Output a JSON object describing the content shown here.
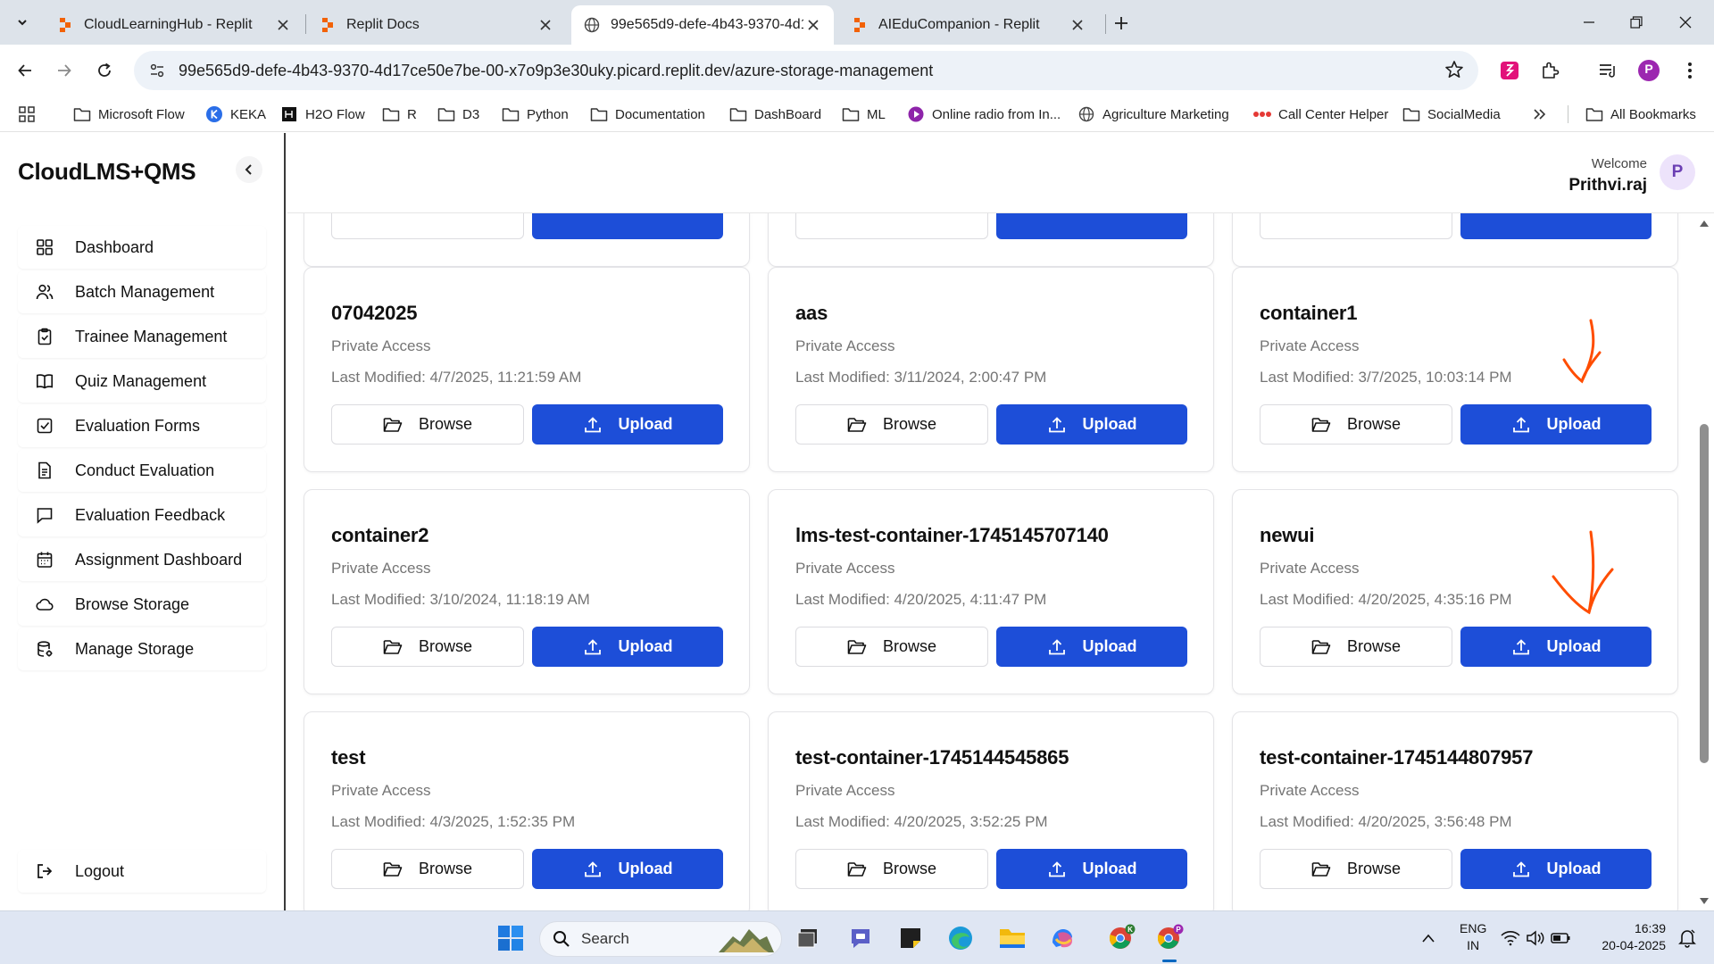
{
  "browser": {
    "tabs": [
      {
        "title": "CloudLearningHub - Replit",
        "favicon": "replit-icon"
      },
      {
        "title": "Replit Docs",
        "favicon": "replit-icon"
      },
      {
        "title": "99e565d9-defe-4b43-9370-4d1",
        "favicon": "globe-icon",
        "active": true
      },
      {
        "title": "AIEduCompanion - Replit",
        "favicon": "replit-icon"
      }
    ],
    "url": "99e565d9-defe-4b43-9370-4d17ce50e7be-00-x7o9p3e30uky.picard.replit.dev/azure-storage-management",
    "profile_initial": "P",
    "bookmarks": [
      {
        "label": "Microsoft Flow",
        "icon": "folder-icon"
      },
      {
        "label": "KEKA",
        "icon": "keka-icon"
      },
      {
        "label": "H2O Flow",
        "icon": "h2o-icon"
      },
      {
        "label": "R",
        "icon": "folder-icon"
      },
      {
        "label": "D3",
        "icon": "folder-icon"
      },
      {
        "label": "Python",
        "icon": "folder-icon"
      },
      {
        "label": "Documentation",
        "icon": "folder-icon"
      },
      {
        "label": "DashBoard",
        "icon": "folder-icon"
      },
      {
        "label": "ML",
        "icon": "folder-icon"
      },
      {
        "label": "Online radio from In...",
        "icon": "radio-icon"
      },
      {
        "label": "Agriculture Marketing",
        "icon": "globe-icon"
      },
      {
        "label": "Call Center Helper",
        "icon": "dots-icon"
      },
      {
        "label": "SocialMedia",
        "icon": "folder-icon"
      }
    ],
    "all_bookmarks": "All Bookmarks"
  },
  "app": {
    "brand": "CloudLMS+QMS",
    "nav": [
      {
        "label": "Dashboard",
        "icon": "grid-icon"
      },
      {
        "label": "Batch Management",
        "icon": "users-icon"
      },
      {
        "label": "Trainee Management",
        "icon": "clipboard-icon"
      },
      {
        "label": "Quiz Management",
        "icon": "book-icon"
      },
      {
        "label": "Evaluation Forms",
        "icon": "checkbox-icon"
      },
      {
        "label": "Conduct Evaluation",
        "icon": "document-icon"
      },
      {
        "label": "Evaluation Feedback",
        "icon": "message-icon"
      },
      {
        "label": "Assignment Dashboard",
        "icon": "calendar-icon"
      },
      {
        "label": "Browse Storage",
        "icon": "cloud-icon"
      },
      {
        "label": "Manage Storage",
        "icon": "storage-icon"
      }
    ],
    "logout": "Logout",
    "header": {
      "welcome": "Welcome",
      "user": "Prithvi.raj",
      "avatar": "P"
    },
    "containers": [
      {
        "name": "07042025",
        "access": "Private Access",
        "modified": "Last Modified: 4/7/2025, 11:21:59 AM"
      },
      {
        "name": "aas",
        "access": "Private Access",
        "modified": "Last Modified: 3/11/2024, 2:00:47 PM"
      },
      {
        "name": "container1",
        "access": "Private Access",
        "modified": "Last Modified: 3/7/2025, 10:03:14 PM"
      },
      {
        "name": "container2",
        "access": "Private Access",
        "modified": "Last Modified: 3/10/2024, 11:18:19 AM"
      },
      {
        "name": "lms-test-container-1745145707140",
        "access": "Private Access",
        "modified": "Last Modified: 4/20/2025, 4:11:47 PM"
      },
      {
        "name": "newui",
        "access": "Private Access",
        "modified": "Last Modified: 4/20/2025, 4:35:16 PM"
      },
      {
        "name": "test",
        "access": "Private Access",
        "modified": "Last Modified: 4/3/2025, 1:52:35 PM"
      },
      {
        "name": "test-container-1745144545865",
        "access": "Private Access",
        "modified": "Last Modified: 4/20/2025, 3:52:25 PM"
      },
      {
        "name": "test-container-1745144807957",
        "access": "Private Access",
        "modified": "Last Modified: 4/20/2025, 3:56:48 PM"
      }
    ],
    "buttons": {
      "browse": "Browse",
      "upload": "Upload"
    },
    "accent_color": "#1d4ed8",
    "annotation_color": "#ff4d00"
  },
  "taskbar": {
    "search": "Search",
    "lang_line1": "ENG",
    "lang_line2": "IN",
    "time": "16:39",
    "date": "20-04-2025"
  }
}
